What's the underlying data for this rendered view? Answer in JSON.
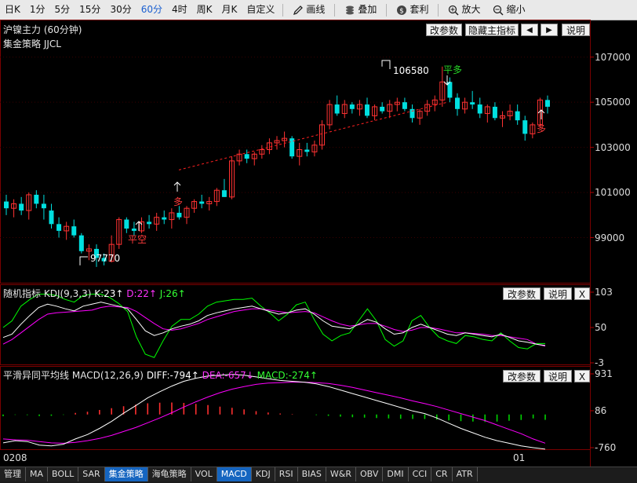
{
  "toolbar": {
    "periods": [
      "日K",
      "1分",
      "5分",
      "15分",
      "30分",
      "60分",
      "4时",
      "周K",
      "月K",
      "自定义"
    ],
    "active_period": "60分",
    "draw_label": "画线",
    "overlay_label": "叠加",
    "arbitrage_label": "套利",
    "zoom_in_label": "放大",
    "zoom_out_label": "缩小"
  },
  "main_panel": {
    "title": "沪镍主力 (60分钟)",
    "strategy": "集金策略 JJCL",
    "buttons": {
      "params": "改参数",
      "hide": "隐藏主指标",
      "prev": "◀",
      "next": "▶",
      "help": "说明"
    },
    "price_axis": [
      "107000",
      "105000",
      "103000",
      "101000",
      "99000"
    ],
    "high_label": "106580",
    "low_label": "97770",
    "signals": [
      {
        "text": "平空",
        "color": "#ff3b3b"
      },
      {
        "text": "多",
        "color": "#ff3b3b"
      },
      {
        "text": "平多",
        "color": "#27d627"
      },
      {
        "text": "多",
        "color": "#ff3b3b"
      }
    ]
  },
  "kdj_panel": {
    "name": "随机指标",
    "params": "KDJ(9,3,3)",
    "k": "K:23↑",
    "d": "D:22↑",
    "j": "J:26↑",
    "axis": [
      "103",
      "50",
      "-3"
    ],
    "buttons": {
      "params": "改参数",
      "help": "说明",
      "close": "X"
    }
  },
  "macd_panel": {
    "name": "平滑异同平均线",
    "params": "MACD(12,26,9)",
    "diff": "DIFF:-794↑",
    "dea": "DEA:-657↓",
    "macd": "MACD:-274↑",
    "axis": [
      "931",
      "86",
      "-760"
    ],
    "buttons": {
      "params": "改参数",
      "help": "说明",
      "close": "X"
    }
  },
  "date_axis": {
    "start": "0208",
    "mid": "01"
  },
  "colors": {
    "up": "#ff3232",
    "down": "#00e0e0",
    "k": "#ffffff",
    "d": "#ff00ff",
    "j": "#00ff00"
  },
  "chart_data": {
    "type": "candlestick",
    "title": "沪镍主力 (60分钟)",
    "ylim": [
      97000,
      108000
    ],
    "candles": [
      [
        100600,
        100900,
        100000,
        100300
      ],
      [
        100300,
        100700,
        99900,
        100500
      ],
      [
        100500,
        100800,
        100000,
        100200
      ],
      [
        100200,
        101000,
        99800,
        100900
      ],
      [
        100900,
        101100,
        100300,
        100500
      ],
      [
        100500,
        100900,
        99800,
        100300
      ],
      [
        100200,
        100500,
        99400,
        99600
      ],
      [
        99600,
        99900,
        99000,
        99300
      ],
      [
        99300,
        99700,
        98900,
        99500
      ],
      [
        99500,
        99800,
        99000,
        99100
      ],
      [
        99100,
        99200,
        98300,
        98400
      ],
      [
        98400,
        98700,
        98000,
        98500
      ],
      [
        98500,
        98700,
        97700,
        98100
      ],
      [
        98100,
        98300,
        97770,
        97950
      ],
      [
        97950,
        99100,
        97900,
        98700
      ],
      [
        98700,
        99900,
        98500,
        99800
      ],
      [
        99800,
        99900,
        99200,
        99400
      ],
      [
        99400,
        99700,
        99100,
        99300
      ],
      [
        99300,
        99900,
        99200,
        99700
      ],
      [
        99700,
        100000,
        99400,
        99600
      ],
      [
        99600,
        100100,
        99300,
        99900
      ],
      [
        99900,
        100200,
        99600,
        99800
      ],
      [
        99800,
        100300,
        99400,
        100100
      ],
      [
        100100,
        100400,
        99800,
        99900
      ],
      [
        99900,
        100400,
        99600,
        100300
      ],
      [
        100300,
        100700,
        100100,
        100600
      ],
      [
        100600,
        100900,
        100300,
        100500
      ],
      [
        100500,
        100800,
        100200,
        100600
      ],
      [
        100600,
        101200,
        100400,
        101100
      ],
      [
        101100,
        101600,
        100800,
        100800
      ],
      [
        100800,
        102600,
        100700,
        102400
      ],
      [
        102400,
        102900,
        102200,
        102700
      ],
      [
        102700,
        102900,
        102300,
        102500
      ],
      [
        102500,
        102800,
        102200,
        102700
      ],
      [
        102700,
        103100,
        102500,
        102900
      ],
      [
        102900,
        103400,
        102700,
        103200
      ],
      [
        103200,
        103500,
        102900,
        103300
      ],
      [
        103300,
        103700,
        103000,
        103400
      ],
      [
        103400,
        103500,
        102500,
        102600
      ],
      [
        102600,
        103200,
        102200,
        102900
      ],
      [
        102900,
        103200,
        102600,
        102800
      ],
      [
        102800,
        103300,
        102600,
        103100
      ],
      [
        103100,
        104200,
        102900,
        104000
      ],
      [
        104000,
        105100,
        103800,
        104900
      ],
      [
        104900,
        105300,
        104400,
        104500
      ],
      [
        104500,
        105100,
        104300,
        104900
      ],
      [
        104900,
        105000,
        104500,
        104700
      ],
      [
        104700,
        105100,
        104400,
        104900
      ],
      [
        104900,
        105200,
        104300,
        104400
      ],
      [
        104400,
        104900,
        104200,
        104800
      ],
      [
        104800,
        105000,
        104500,
        104600
      ],
      [
        104600,
        105100,
        104300,
        104900
      ],
      [
        104900,
        105200,
        104600,
        105000
      ],
      [
        105000,
        105200,
        104600,
        104700
      ],
      [
        104700,
        104900,
        104100,
        104300
      ],
      [
        104300,
        104700,
        104000,
        104600
      ],
      [
        104600,
        105100,
        104400,
        104900
      ],
      [
        104900,
        105300,
        104600,
        105100
      ],
      [
        105100,
        106580,
        104800,
        105900
      ],
      [
        105900,
        106100,
        105000,
        105200
      ],
      [
        105200,
        105400,
        104400,
        104700
      ],
      [
        104700,
        105200,
        104500,
        105000
      ],
      [
        105000,
        105500,
        104700,
        104900
      ],
      [
        104900,
        105200,
        104300,
        104500
      ],
      [
        104500,
        104900,
        104100,
        104800
      ],
      [
        104800,
        105000,
        104200,
        104300
      ],
      [
        104300,
        104600,
        103900,
        104400
      ],
      [
        104400,
        104900,
        104200,
        104600
      ],
      [
        104600,
        104900,
        104000,
        104200
      ],
      [
        104200,
        104400,
        103300,
        103600
      ],
      [
        103600,
        104100,
        103400,
        104000
      ],
      [
        104000,
        105200,
        103900,
        105100
      ],
      [
        105100,
        105300,
        104500,
        104800
      ]
    ],
    "kdj": {
      "k": [
        35,
        40,
        55,
        68,
        80,
        85,
        82,
        78,
        75,
        82,
        85,
        88,
        85,
        82,
        78,
        62,
        45,
        38,
        42,
        48,
        52,
        55,
        60,
        68,
        72,
        75,
        78,
        80,
        82,
        78,
        74,
        70,
        72,
        76,
        78,
        70,
        60,
        52,
        50,
        48,
        55,
        62,
        58,
        48,
        40,
        42,
        50,
        55,
        50,
        45,
        40,
        38,
        42,
        40,
        38,
        36,
        40,
        35,
        30,
        28,
        25,
        23
      ],
      "d": [
        25,
        32,
        42,
        52,
        62,
        70,
        72,
        73,
        74,
        75,
        76,
        80,
        82,
        81,
        80,
        74,
        65,
        56,
        48,
        46,
        48,
        52,
        56,
        62,
        66,
        70,
        74,
        76,
        78,
        78,
        76,
        74,
        72,
        73,
        74,
        72,
        66,
        60,
        55,
        52,
        54,
        56,
        56,
        52,
        47,
        44,
        46,
        50,
        50,
        48,
        45,
        42,
        42,
        41,
        40,
        38,
        38,
        36,
        34,
        32,
        25,
        22
      ],
      "j": [
        50,
        60,
        82,
        92,
        100,
        100,
        98,
        92,
        88,
        98,
        100,
        100,
        95,
        86,
        74,
        36,
        10,
        5,
        30,
        52,
        62,
        62,
        70,
        82,
        88,
        90,
        92,
        92,
        94,
        82,
        72,
        60,
        70,
        84,
        88,
        62,
        40,
        30,
        38,
        42,
        60,
        78,
        60,
        32,
        22,
        30,
        60,
        68,
        50,
        36,
        30,
        26,
        38,
        36,
        32,
        30,
        42,
        30,
        20,
        18,
        26,
        26
      ]
    },
    "macd": {
      "diff": [
        -650,
        -600,
        -620,
        -700,
        -720,
        -680,
        -560,
        -460,
        -320,
        -160,
        30,
        200,
        380,
        520,
        650,
        760,
        830,
        880,
        900,
        920,
        900,
        860,
        820,
        780,
        760,
        740,
        700,
        640,
        560,
        480,
        400,
        320,
        240,
        160,
        80,
        20,
        -80,
        -200,
        -320,
        -420,
        -520,
        -600,
        -660,
        -720,
        -760,
        -794
      ],
      "dea": [
        -560,
        -580,
        -590,
        -620,
        -650,
        -660,
        -640,
        -600,
        -550,
        -480,
        -390,
        -300,
        -190,
        -80,
        40,
        170,
        290,
        400,
        500,
        580,
        640,
        690,
        720,
        730,
        740,
        740,
        730,
        710,
        670,
        620,
        560,
        500,
        440,
        380,
        310,
        250,
        180,
        100,
        20,
        -60,
        -140,
        -240,
        -340,
        -440,
        -560,
        -657
      ],
      "hist": [
        -90,
        -20,
        -30,
        -80,
        -70,
        -20,
        80,
        140,
        230,
        320,
        420,
        500,
        570,
        600,
        610,
        590,
        540,
        480,
        400,
        340,
        260,
        170,
        100,
        50,
        20,
        0,
        -30,
        -70,
        -110,
        -140,
        -160,
        -180,
        -200,
        -220,
        -230,
        -230,
        -260,
        -300,
        -340,
        -360,
        -380,
        -360,
        -320,
        -280,
        -200,
        -274
      ]
    },
    "kdj_ylim": [
      -3,
      103
    ],
    "macd_ylim": [
      -760,
      931
    ]
  }
}
